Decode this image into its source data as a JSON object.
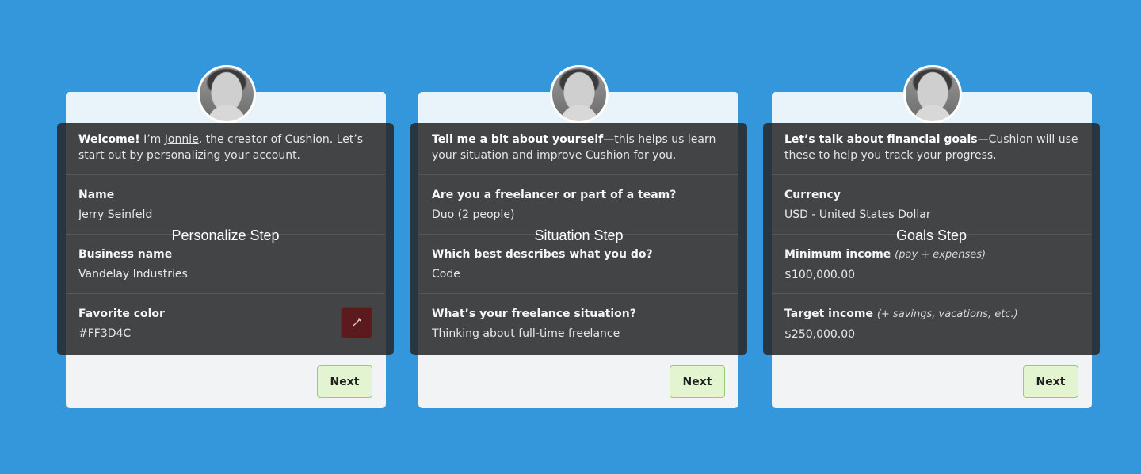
{
  "cards": [
    {
      "step_title": "Personalize Step",
      "intro_bold": "Welcome!",
      "intro_pre": " I’m ",
      "intro_link": "Jonnie",
      "intro_rest": ", the creator of Cushion. Let’s start out by personalizing your account.",
      "fields": [
        {
          "label": "Name",
          "value": "Jerry Seinfeld"
        },
        {
          "label": "Business name",
          "value": "Vandelay Industries"
        },
        {
          "label": "Favorite color",
          "value": "#FF3D4C"
        }
      ],
      "swatch_icon": "eyedropper-icon",
      "next_label": "Next"
    },
    {
      "step_title": "Situation Step",
      "intro_bold": "Tell me a bit about yourself",
      "intro_rest": "—this helps us learn your situation and improve Cushion for you.",
      "fields": [
        {
          "label": "Are you a freelancer or part of a team?",
          "value": "Duo (2 people)"
        },
        {
          "label": "Which best describes what you do?",
          "value": "Code"
        },
        {
          "label": "What’s your freelance situation?",
          "value": "Thinking about full-time freelance"
        }
      ],
      "next_label": "Next"
    },
    {
      "step_title": "Goals Step",
      "intro_bold": "Let’s talk about financial goals",
      "intro_rest": "—Cushion will use these to help you track your progress.",
      "fields": [
        {
          "label": "Currency",
          "value": "USD - United States Dollar"
        },
        {
          "label": "Minimum income",
          "note": "(pay + expenses)",
          "value": "$100,000.00"
        },
        {
          "label": "Target income",
          "note": "(+ savings, vacations, etc.)",
          "value": "$250,000.00"
        }
      ],
      "next_label": "Next"
    }
  ],
  "colors": {
    "background": "#3497DB",
    "next_button": "#E2F5D0",
    "favorite_color": "#FF3D4C"
  }
}
